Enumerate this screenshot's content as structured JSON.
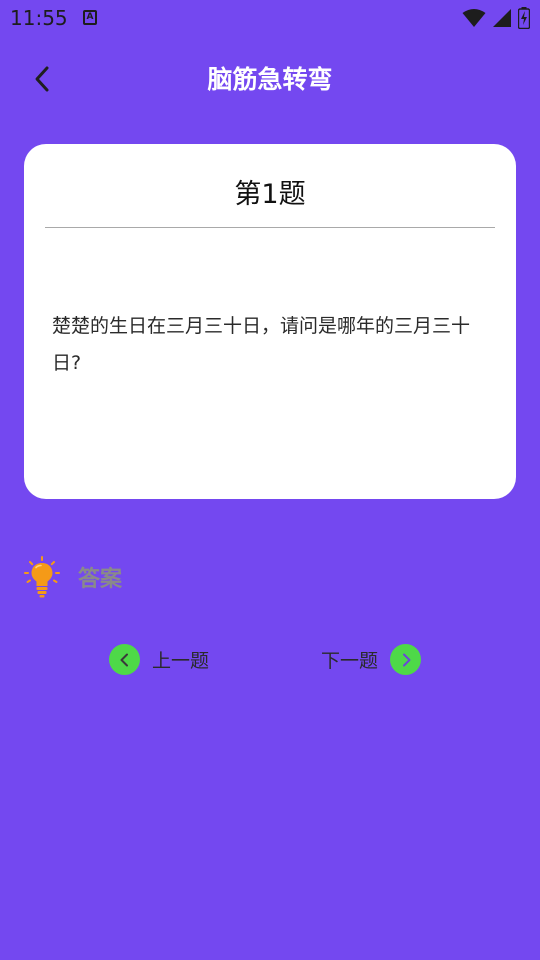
{
  "status_bar": {
    "time": "11:55",
    "app_icon_letter": "A",
    "icons": [
      "wifi-icon",
      "signal-icon",
      "battery-charging-icon"
    ]
  },
  "header": {
    "title": "脑筋急转弯",
    "back_icon": "chevron-left-icon"
  },
  "question": {
    "title": "第1题",
    "text": "楚楚的生日在三月三十日，请问是哪年的三月三十日?"
  },
  "answer": {
    "label": "答案",
    "icon": "lightbulb-icon"
  },
  "navigation": {
    "prev_label": "上一题",
    "next_label": "下一题"
  },
  "colors": {
    "background": "#7448F0",
    "card": "#FFFFFF",
    "nav_button": "#4ED948",
    "bulb": "#F59A17"
  }
}
